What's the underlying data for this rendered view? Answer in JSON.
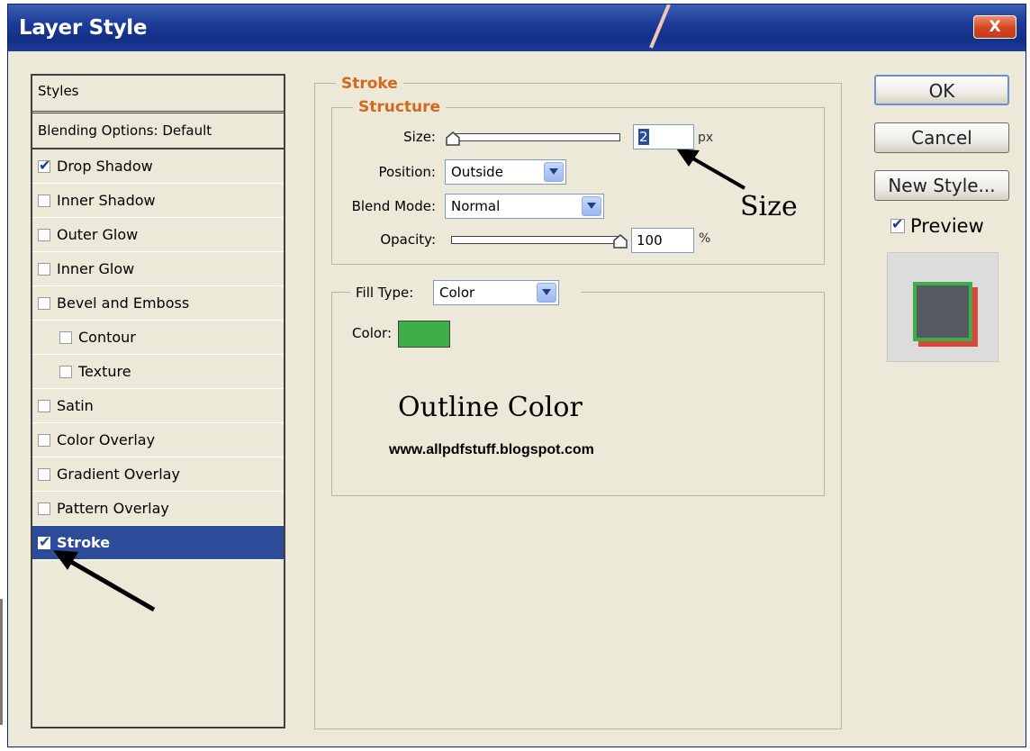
{
  "window": {
    "title": "Layer Style",
    "close_glyph": "X"
  },
  "styles_panel": {
    "header": "Styles",
    "blending_options": "Blending Options: Default",
    "items": [
      {
        "label": "Drop Shadow",
        "checked": true
      },
      {
        "label": "Inner Shadow",
        "checked": false
      },
      {
        "label": "Outer Glow",
        "checked": false
      },
      {
        "label": "Inner Glow",
        "checked": false
      },
      {
        "label": "Bevel and Emboss",
        "checked": false
      },
      {
        "label": "Contour",
        "checked": false
      },
      {
        "label": "Texture",
        "checked": false
      },
      {
        "label": "Satin",
        "checked": false
      },
      {
        "label": "Color Overlay",
        "checked": false
      },
      {
        "label": "Gradient Overlay",
        "checked": false
      },
      {
        "label": "Pattern Overlay",
        "checked": false
      },
      {
        "label": "Stroke",
        "checked": true,
        "selected": true
      }
    ]
  },
  "stroke": {
    "section_title": "Stroke",
    "structure_title": "Structure",
    "size": {
      "label": "Size:",
      "value": "2",
      "unit": "px",
      "slider_fraction": 0.01
    },
    "position": {
      "label": "Position:",
      "value": "Outside"
    },
    "blend_mode": {
      "label": "Blend Mode:",
      "value": "Normal"
    },
    "opacity": {
      "label": "Opacity:",
      "value": "100",
      "unit": "%",
      "slider_fraction": 1.0
    },
    "fill_type": {
      "label": "Fill Type:",
      "value": "Color"
    },
    "color": {
      "label": "Color:",
      "swatch": "#3fae49"
    }
  },
  "buttons": {
    "ok": "OK",
    "cancel": "Cancel",
    "new_style": "New Style..."
  },
  "preview": {
    "label": "Preview",
    "checked": true,
    "fill": "#555a60",
    "stroke": "#3fae49",
    "shadow": "#d9493a"
  },
  "annotations": {
    "size": "Size",
    "outline_color": "Outline Color",
    "watermark": "www.allpdfstuff.blogspot.com"
  },
  "colors": {
    "titlebar": "#132f86",
    "dialog_bg": "#ece9d8",
    "selected_row": "#2c4b98",
    "section_title": "#d2691e"
  }
}
